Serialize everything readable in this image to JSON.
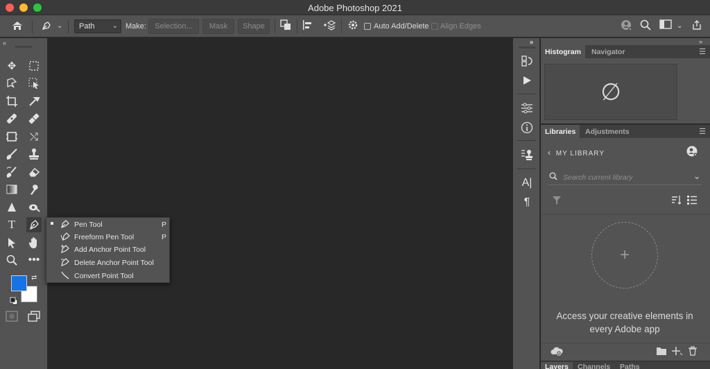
{
  "window": {
    "title": "Adobe Photoshop 2021"
  },
  "optionsbar": {
    "mode_value": "Path",
    "make_label": "Make:",
    "selection_label": "Selection...",
    "mask_label": "Mask",
    "shape_label": "Shape",
    "auto_add_delete_label": "Auto Add/Delete",
    "align_edges_label": "Align Edges"
  },
  "flyout": {
    "items": [
      {
        "label": "Pen Tool",
        "shortcut": "P",
        "selected": true,
        "icon": "pen-icon"
      },
      {
        "label": "Freeform Pen Tool",
        "shortcut": "P",
        "selected": false,
        "icon": "freeform-pen-icon"
      },
      {
        "label": "Add Anchor Point Tool",
        "shortcut": "",
        "selected": false,
        "icon": "add-anchor-icon"
      },
      {
        "label": "Delete Anchor Point Tool",
        "shortcut": "",
        "selected": false,
        "icon": "delete-anchor-icon"
      },
      {
        "label": "Convert Point Tool",
        "shortcut": "",
        "selected": false,
        "icon": "convert-point-icon"
      }
    ]
  },
  "colors": {
    "foreground": "#1473e6",
    "background": "#ffffff"
  },
  "panels": {
    "histogram": {
      "tabs": [
        "Histogram",
        "Navigator"
      ]
    },
    "libraries": {
      "tabs": [
        "Libraries",
        "Adjustments"
      ],
      "library_name": "MY LIBRARY",
      "search_placeholder": "Search current library",
      "message": "Access your creative elements in every Adobe app"
    },
    "layers": {
      "tabs": [
        "Layers",
        "Channels",
        "Paths"
      ]
    }
  }
}
